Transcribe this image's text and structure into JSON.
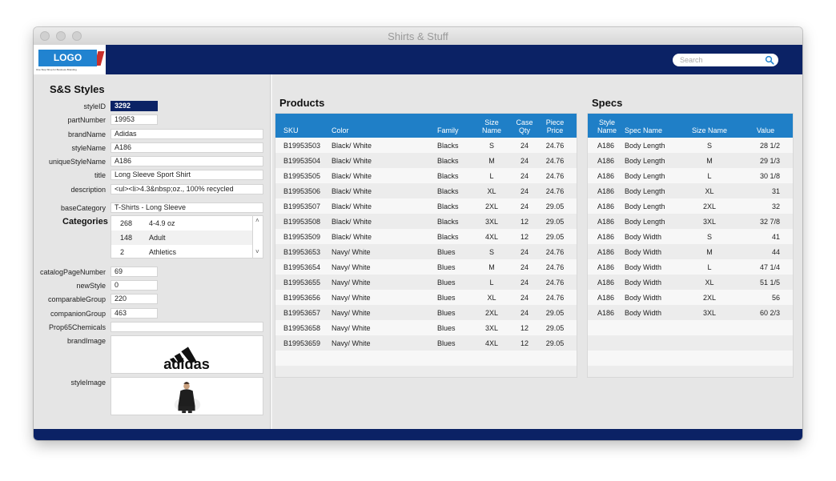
{
  "window": {
    "title": "Shirts & Stuff"
  },
  "header": {
    "logo_text": "LOGO",
    "logo_tagline": "One Stop Shop for Business Branding",
    "search_placeholder": "Search"
  },
  "style": {
    "section_title": "S&S Styles",
    "fields": [
      {
        "label": "styleID",
        "value": "3292"
      },
      {
        "label": "partNumber",
        "value": "19953"
      },
      {
        "label": "brandName",
        "value": "Adidas"
      },
      {
        "label": "styleName",
        "value": "A186"
      },
      {
        "label": "uniqueStyleName",
        "value": "A186"
      },
      {
        "label": "title",
        "value": "Long Sleeve Sport Shirt"
      },
      {
        "label": "description",
        "value": "<ul><li>4.3&nbsp;oz., 100% recycled"
      },
      {
        "label": "baseCategory",
        "value": "T-Shirts - Long Sleeve"
      }
    ],
    "categories_label": "Categories",
    "categories": [
      {
        "id": "268",
        "name": "4-4.9 oz"
      },
      {
        "id": "148",
        "name": "Adult"
      },
      {
        "id": "2",
        "name": "Athletics"
      }
    ],
    "fields2": [
      {
        "label": "catalogPageNumber",
        "value": "69"
      },
      {
        "label": "newStyle",
        "value": "0"
      },
      {
        "label": "comparableGroup",
        "value": "220"
      },
      {
        "label": "companionGroup",
        "value": "463"
      },
      {
        "label": "Prop65Chemicals",
        "value": ""
      }
    ],
    "brand_image_label": "brandImage",
    "brand_logo_text": "adidas",
    "style_image_label": "styleImage"
  },
  "products": {
    "title": "Products",
    "headers": {
      "sku": "SKU",
      "color": "Color",
      "family": "Family",
      "size1": "Size",
      "size2": "Name",
      "case1": "Case",
      "case2": "Qty",
      "price1": "Piece",
      "price2": "Price"
    },
    "rows": [
      {
        "sku": "B19953503",
        "color": "Black/ White",
        "family": "Blacks",
        "size": "S",
        "qty": "24",
        "price": "24.76"
      },
      {
        "sku": "B19953504",
        "color": "Black/ White",
        "family": "Blacks",
        "size": "M",
        "qty": "24",
        "price": "24.76"
      },
      {
        "sku": "B19953505",
        "color": "Black/ White",
        "family": "Blacks",
        "size": "L",
        "qty": "24",
        "price": "24.76"
      },
      {
        "sku": "B19953506",
        "color": "Black/ White",
        "family": "Blacks",
        "size": "XL",
        "qty": "24",
        "price": "24.76"
      },
      {
        "sku": "B19953507",
        "color": "Black/ White",
        "family": "Blacks",
        "size": "2XL",
        "qty": "24",
        "price": "29.05"
      },
      {
        "sku": "B19953508",
        "color": "Black/ White",
        "family": "Blacks",
        "size": "3XL",
        "qty": "12",
        "price": "29.05"
      },
      {
        "sku": "B19953509",
        "color": "Black/ White",
        "family": "Blacks",
        "size": "4XL",
        "qty": "12",
        "price": "29.05"
      },
      {
        "sku": "B19953653",
        "color": "Navy/ White",
        "family": "Blues",
        "size": "S",
        "qty": "24",
        "price": "24.76"
      },
      {
        "sku": "B19953654",
        "color": "Navy/ White",
        "family": "Blues",
        "size": "M",
        "qty": "24",
        "price": "24.76"
      },
      {
        "sku": "B19953655",
        "color": "Navy/ White",
        "family": "Blues",
        "size": "L",
        "qty": "24",
        "price": "24.76"
      },
      {
        "sku": "B19953656",
        "color": "Navy/ White",
        "family": "Blues",
        "size": "XL",
        "qty": "24",
        "price": "24.76"
      },
      {
        "sku": "B19953657",
        "color": "Navy/ White",
        "family": "Blues",
        "size": "2XL",
        "qty": "24",
        "price": "29.05"
      },
      {
        "sku": "B19953658",
        "color": "Navy/ White",
        "family": "Blues",
        "size": "3XL",
        "qty": "12",
        "price": "29.05"
      },
      {
        "sku": "B19953659",
        "color": "Navy/ White",
        "family": "Blues",
        "size": "4XL",
        "qty": "12",
        "price": "29.05"
      }
    ]
  },
  "specs": {
    "title": "Specs",
    "headers": {
      "style1": "Style",
      "style2": "Name",
      "spec": "Spec Name",
      "size": "Size Name",
      "value": "Value"
    },
    "rows": [
      {
        "style": "A186",
        "spec": "Body Length",
        "size": "S",
        "value": "28 1/2"
      },
      {
        "style": "A186",
        "spec": "Body Length",
        "size": "M",
        "value": "29 1/3"
      },
      {
        "style": "A186",
        "spec": "Body Length",
        "size": "L",
        "value": "30 1/8"
      },
      {
        "style": "A186",
        "spec": "Body Length",
        "size": "XL",
        "value": "31"
      },
      {
        "style": "A186",
        "spec": "Body Length",
        "size": "2XL",
        "value": "32"
      },
      {
        "style": "A186",
        "spec": "Body Length",
        "size": "3XL",
        "value": "32 7/8"
      },
      {
        "style": "A186",
        "spec": "Body Width",
        "size": "S",
        "value": "41"
      },
      {
        "style": "A186",
        "spec": "Body Width",
        "size": "M",
        "value": "44"
      },
      {
        "style": "A186",
        "spec": "Body Width",
        "size": "L",
        "value": "47 1/4"
      },
      {
        "style": "A186",
        "spec": "Body Width",
        "size": "XL",
        "value": "51 1/5"
      },
      {
        "style": "A186",
        "spec": "Body Width",
        "size": "2XL",
        "value": "56"
      },
      {
        "style": "A186",
        "spec": "Body Width",
        "size": "3XL",
        "value": "60 2/3"
      }
    ]
  },
  "colors": {
    "navy": "#0b2265",
    "header_blue": "#1f7fc7",
    "panel": "#e5e5e5"
  }
}
